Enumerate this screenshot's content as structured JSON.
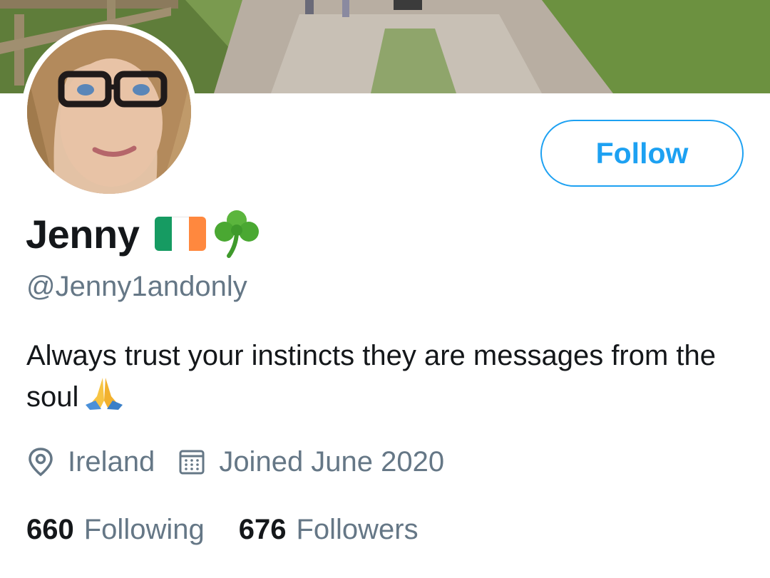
{
  "profile": {
    "name": "Jenny",
    "handle": "@Jenny1andonly",
    "bio": "Always trust your instincts they are messages from the soul",
    "location": "Ireland",
    "joined": "Joined June 2020",
    "name_emojis": [
      "ireland-flag-icon",
      "shamrock-icon"
    ],
    "bio_emoji": "folded-hands-icon"
  },
  "actions": {
    "follow_label": "Follow"
  },
  "stats": {
    "following_count": "660",
    "following_label": "Following",
    "followers_count": "676",
    "followers_label": "Followers"
  },
  "colors": {
    "accent": "#1da1f2",
    "text_primary": "#14171a",
    "text_secondary": "#657786",
    "flag_green": "#169b62",
    "flag_white": "#ffffff",
    "flag_orange": "#ff883e"
  }
}
